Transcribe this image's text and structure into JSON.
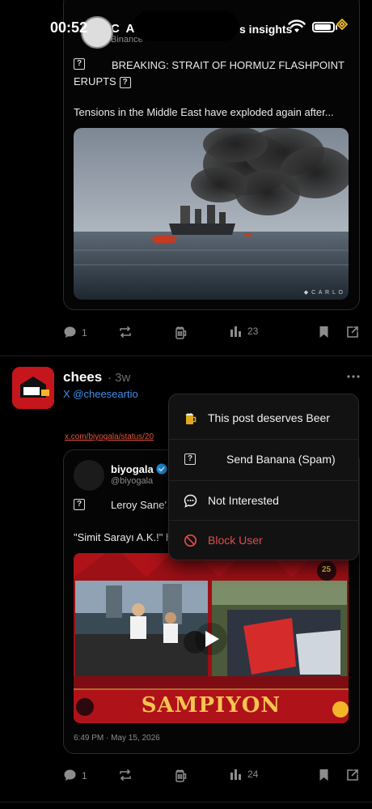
{
  "status_bar": {
    "time": "00:52",
    "icons": [
      "wifi-icon",
      "battery-icon",
      "binance-icon"
    ]
  },
  "post1": {
    "author_name": "C A R",
    "author_sub": "Binance",
    "header_suffix": "s insights",
    "headline": "BREAKING: STRAIT OF HORMUZ FLASHPOINT",
    "headline_line2": "ERUPTS",
    "body": "Tensions in the Middle East have exploded again after...",
    "image_watermark": "◆ C A R L O",
    "image_alt": "Burning ship at sea with lifeboat",
    "actions": {
      "comments": "1",
      "reposts": "",
      "views": "23"
    }
  },
  "post2": {
    "author_name": "chees",
    "time_ago": "· 3w",
    "handle": "X @cheeseartio",
    "link_text": "x.com/biyogala/status/20",
    "quoted": {
      "author_name": "biyogala",
      "handle": "@biyogala",
      "text1": "Leroy Sane'",
      "text2": "\"Simit Sarayı A.K.!\" h",
      "timestamp": "6:49 PM · May 15, 2026",
      "image_banner": "SAMPIYON",
      "image_badge": "25"
    },
    "actions": {
      "comments": "1",
      "reposts": "",
      "views": "24"
    }
  },
  "menu": {
    "items": [
      {
        "label": "This post deserves Beer",
        "icon": "beer-icon"
      },
      {
        "label": "Send Banana (Spam)",
        "icon": "unknown-glyph-icon"
      },
      {
        "label": "Not Interested",
        "icon": "chat-dots-icon"
      },
      {
        "label": "Block User",
        "icon": "block-icon"
      }
    ]
  },
  "colors": {
    "background": "#000000",
    "accent_link": "#3f8fe6",
    "danger": "#e24b4b",
    "url": "#e8553c",
    "brand_red": "#c4161c"
  }
}
